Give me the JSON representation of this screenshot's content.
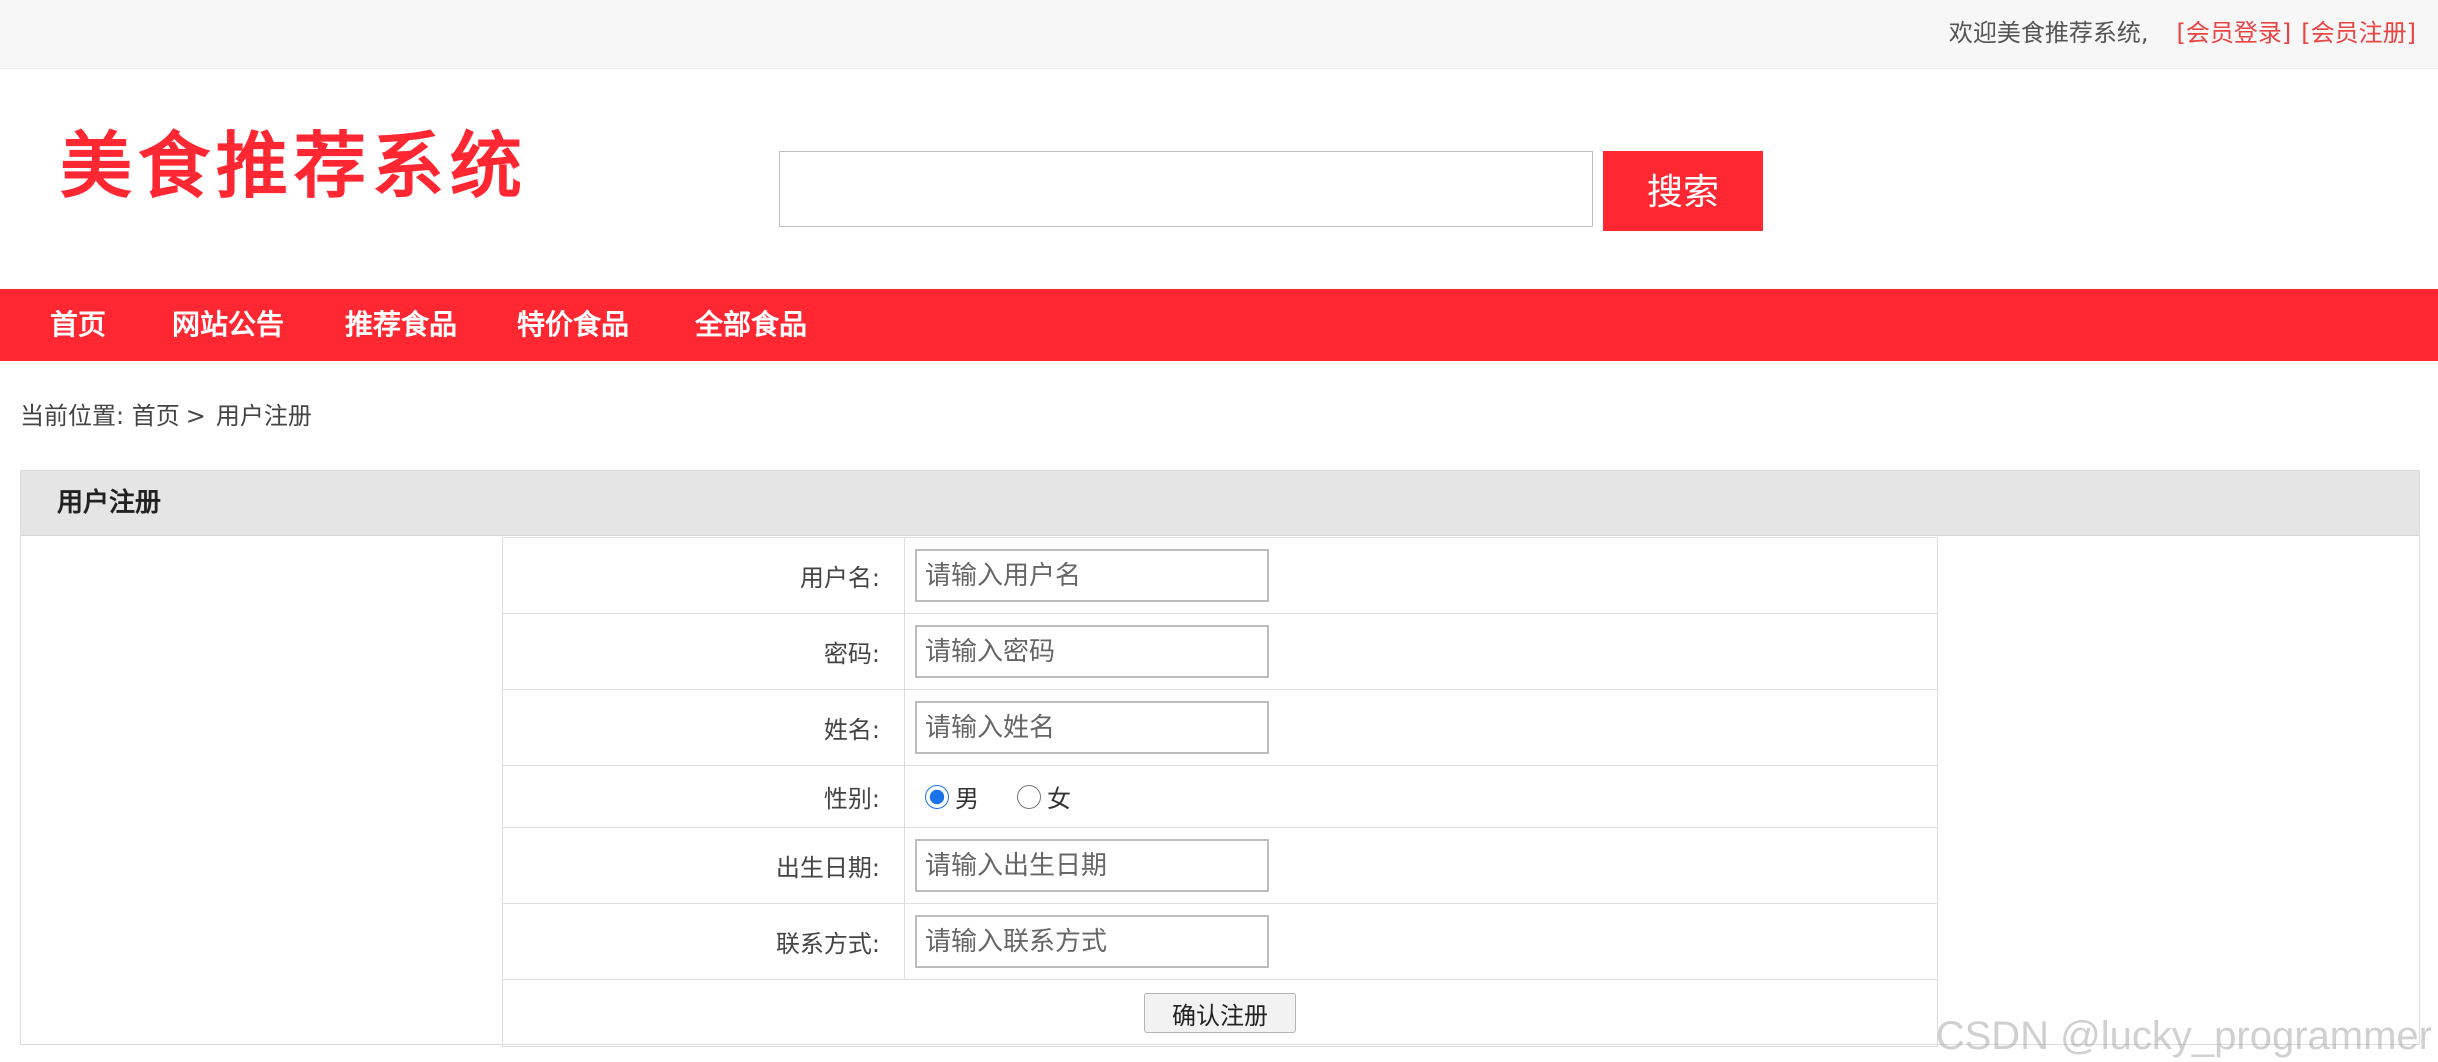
{
  "topbar": {
    "welcome": "欢迎美食推荐系统,",
    "login_link": "[会员登录]",
    "register_link": "[会员注册]"
  },
  "header": {
    "logo": "美食推荐系统",
    "search": {
      "value": "",
      "placeholder": "",
      "button": "搜索"
    }
  },
  "nav": {
    "items": [
      {
        "label": "首页"
      },
      {
        "label": "网站公告"
      },
      {
        "label": "推荐食品"
      },
      {
        "label": "特价食品"
      },
      {
        "label": "全部食品"
      }
    ]
  },
  "breadcrumb": {
    "prefix": "当前位置:",
    "home": "首页",
    "separator": ">",
    "current": "用户注册"
  },
  "panel": {
    "title": "用户注册",
    "form": {
      "username": {
        "label": "用户名:",
        "placeholder": "请输入用户名"
      },
      "password": {
        "label": "密码:",
        "placeholder": "请输入密码"
      },
      "name": {
        "label": "姓名:",
        "placeholder": "请输入姓名"
      },
      "gender": {
        "label": "性别:",
        "options": [
          {
            "label": "男",
            "checked": true
          },
          {
            "label": "女",
            "checked": false
          }
        ]
      },
      "birthdate": {
        "label": "出生日期:",
        "placeholder": "请输入出生日期"
      },
      "contact": {
        "label": "联系方式:",
        "placeholder": "请输入联系方式"
      },
      "submit": "确认注册"
    }
  },
  "watermark": "CSDN @lucky_programmer",
  "colors": {
    "brand": "#ff2832",
    "link": "#e84545",
    "panel_head": "#e5e5e5",
    "radio": "#1a73e8"
  }
}
